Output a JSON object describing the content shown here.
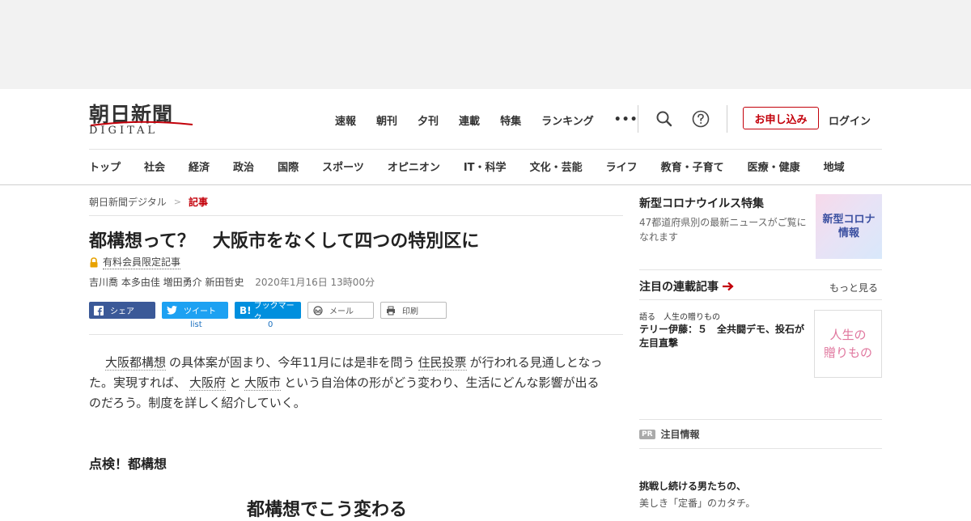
{
  "logo": {
    "main": "朝日新聞",
    "sub": "DIGITAL"
  },
  "topnav": [
    "速報",
    "朝刊",
    "夕刊",
    "連載",
    "特集",
    "ランキング"
  ],
  "topnav_more": "•••",
  "header": {
    "subscribe": "お申し込み",
    "login": "ログイン"
  },
  "icons": {
    "search": "search-icon",
    "help": "question-icon"
  },
  "catnav": [
    "トップ",
    "社会",
    "経済",
    "政治",
    "国際",
    "スポーツ",
    "オピニオン",
    "IT・科学",
    "文化・芸能",
    "ライフ",
    "教育・子育て",
    "医療・健康",
    "地域"
  ],
  "breadcrumb": {
    "home": "朝日新聞デジタル",
    "sep": ">",
    "current": "記事"
  },
  "article": {
    "title": "都構想って？　大阪市をなくして四つの特別区に",
    "members_label": "有料会員限定記事",
    "authors": "吉川喬 本多由佳 増田勇介 新田哲史",
    "date": "2020年1月16日 13時00分",
    "lead": {
      "t1": "大阪都構想",
      "t2": "の具体案が固まり、今年11月には是非を問う",
      "t3": "住民投票",
      "t4": "が行われる見通しとなった。実現すれば、",
      "t5": "大阪府",
      "t6": "と",
      "t7": "大阪市",
      "t8": "という自治体の形がどう変わり、生活にどんな影響が出るのだろう。制度を詳しく紹介していく。"
    },
    "section_heading": "点検！都構想",
    "figure_title": "都構想でこう変わる"
  },
  "share": {
    "facebook": "シェア",
    "twitter": "ツイート",
    "hatena": "ブックマーク",
    "mail": "メール",
    "print": "印刷",
    "twitter_count": "list",
    "hatena_count": "0"
  },
  "sidebar": {
    "corona": {
      "heading": "新型コロナウイルス特集",
      "desc": "47都道府県別の最新ニュースがご覧になれます",
      "img_l1": "新型コロナ",
      "img_l2": "情報"
    },
    "series": {
      "heading": "注目の連載記事",
      "more": "もっと見る",
      "sub": "語る　人生の贈りもの",
      "title": "テリー伊藤：５　全共闘デモ、投石が左目直撃",
      "img_l1": "人生の",
      "img_l2": "贈りもの"
    },
    "pr": {
      "badge": "PR",
      "label": "注目情報"
    },
    "promo": {
      "title": "挑戦し続ける男たちの、",
      "sub": "美しき「定番」のカタチ。"
    }
  },
  "colors": {
    "accent": "#c3000a",
    "facebook": "#3b5998",
    "twitter": "#1da1f2",
    "hatena": "#008fde"
  }
}
